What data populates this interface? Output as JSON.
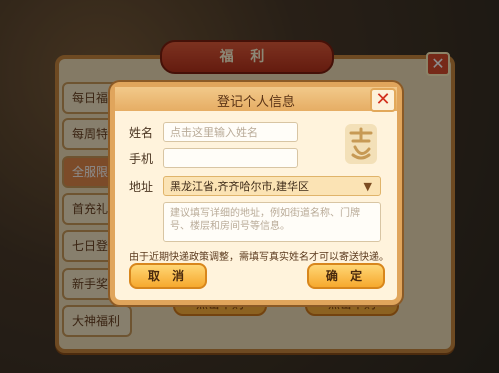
{
  "welfare": {
    "title": "福 利",
    "tabs": [
      "每日福",
      "每周特",
      "全服限",
      "首充礼",
      "七日登录",
      "新手奖",
      "大神福利"
    ],
    "buy_buttons": [
      "点击申购",
      "点击申购"
    ]
  },
  "dialog": {
    "title": "登记个人信息",
    "name_label": "姓名",
    "name_placeholder": "点击这里输入姓名",
    "phone_label": "手机",
    "phone_value": "",
    "address_label": "地址",
    "address_selected": "黑龙江省,齐齐哈尔市,建华区",
    "detail_placeholder": "建议填写详细的地址，例如街道名称、门牌号、楼层和房间号等信息。",
    "notice": "由于近期快递政策调整，需填写真实姓名才可以寄送快递。",
    "cancel_label": "取 消",
    "confirm_label": "确 定"
  }
}
